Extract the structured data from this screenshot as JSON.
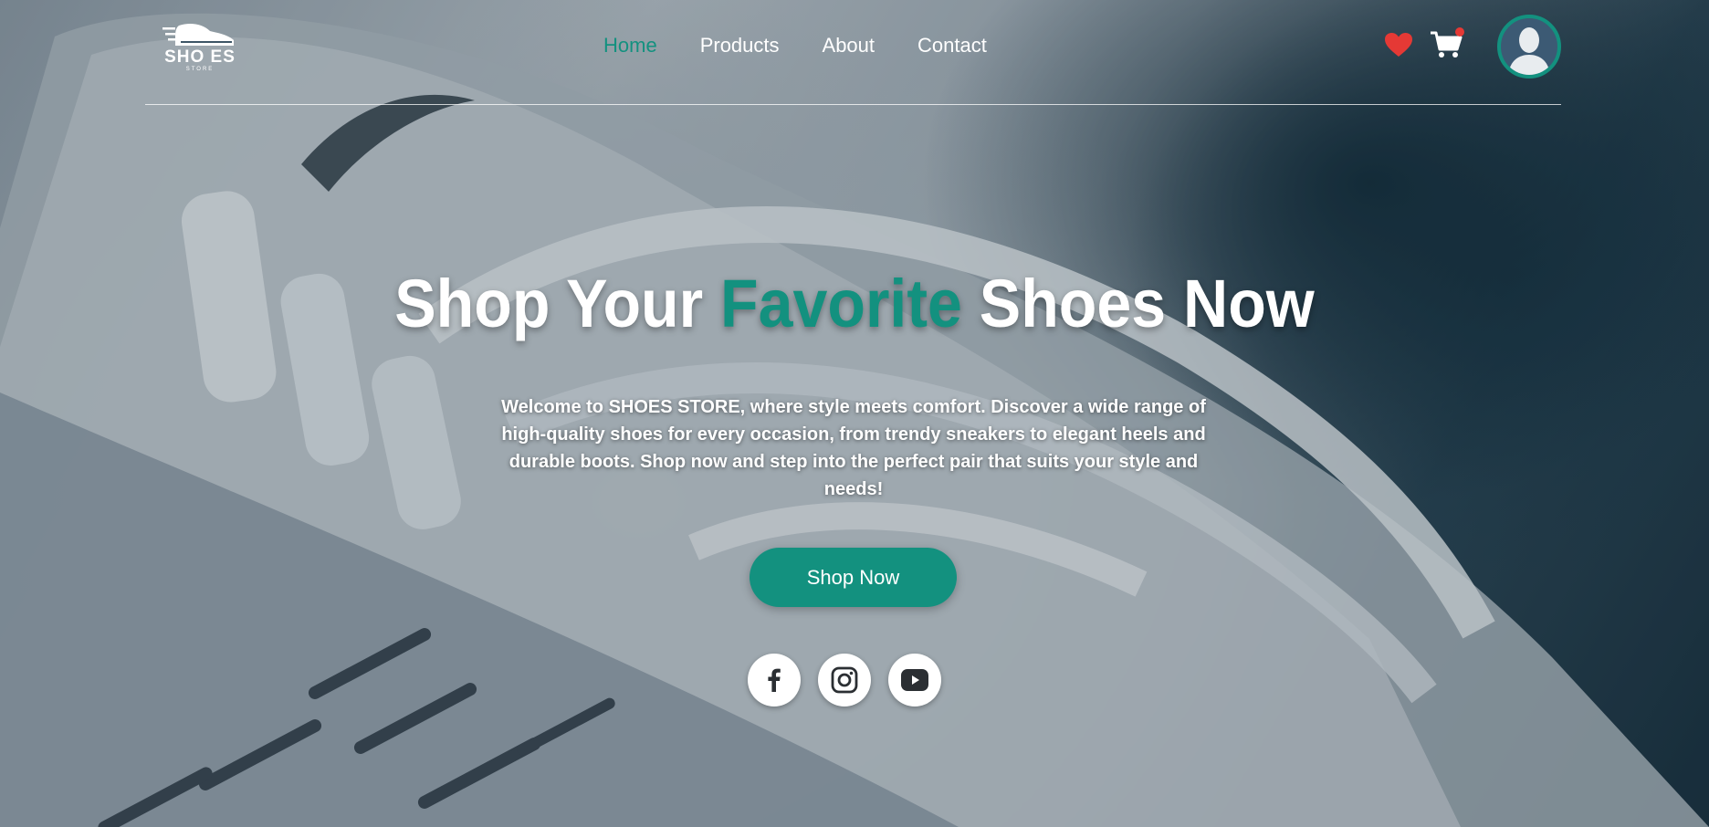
{
  "brand": {
    "logo_text": "SHO ES",
    "logo_sub": "STORE"
  },
  "nav": {
    "items": [
      {
        "label": "Home",
        "active": true
      },
      {
        "label": "Products",
        "active": false
      },
      {
        "label": "About",
        "active": false
      },
      {
        "label": "Contact",
        "active": false
      }
    ]
  },
  "header_icons": [
    "heart-icon",
    "cart-icon",
    "avatar"
  ],
  "hero": {
    "title_before": "Shop Your ",
    "title_accent": "Favorite",
    "title_after": " Shoes Now",
    "description": "Welcome to SHOES STORE, where style meets comfort. Discover a wide range of high-quality shoes for every occasion, from trendy sneakers to elegant heels and durable boots. Shop now and step into the perfect pair that suits your style and needs!",
    "cta_label": "Shop Now"
  },
  "socials": [
    "facebook-icon",
    "instagram-icon",
    "youtube-icon"
  ],
  "colors": {
    "accent": "#13917f",
    "text": "#ffffff",
    "favorite": "#e53935"
  }
}
